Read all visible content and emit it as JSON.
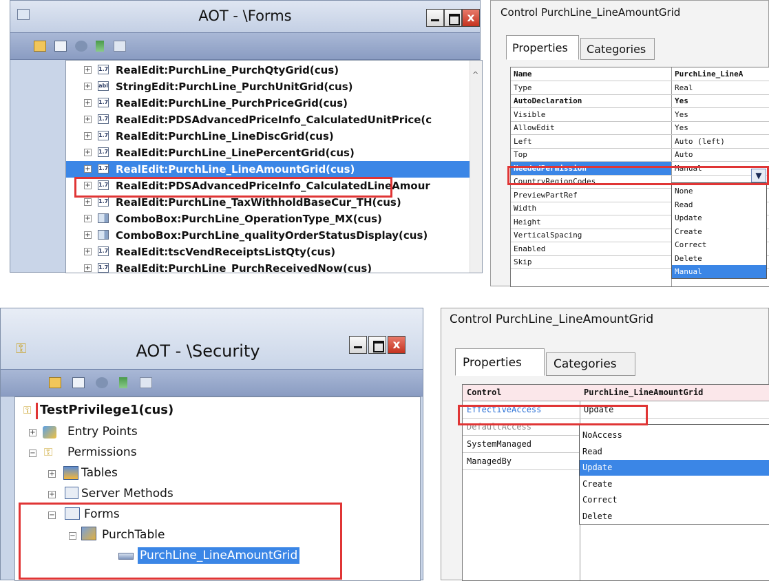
{
  "aot_forms": {
    "title": "AOT - \\Forms",
    "close_label": "x",
    "rows": [
      {
        "icon": "1.7",
        "label": "RealEdit:PurchLine_PurchQtyGrid(cus)"
      },
      {
        "icon": "abl",
        "label": "StringEdit:PurchLine_PurchUnitGrid(cus)"
      },
      {
        "icon": "1.7",
        "label": "RealEdit:PurchLine_PurchPriceGrid(cus)"
      },
      {
        "icon": "1.7",
        "label": "RealEdit:PDSAdvancedPriceInfo_CalculatedUnitPrice(c"
      },
      {
        "icon": "1.7",
        "label": "RealEdit:PurchLine_LineDiscGrid(cus)"
      },
      {
        "icon": "1.7",
        "label": "RealEdit:PurchLine_LinePercentGrid(cus)"
      },
      {
        "icon": "1.7",
        "label": "RealEdit:PurchLine_LineAmountGrid(cus)"
      },
      {
        "icon": "1.7",
        "label": "RealEdit:PDSAdvancedPriceInfo_CalculatedLineAmour"
      },
      {
        "icon": "1.7",
        "label": "RealEdit:PurchLine_TaxWithholdBaseCur_TH(cus)"
      },
      {
        "icon": "",
        "label": "ComboBox:PurchLine_OperationType_MX(cus)"
      },
      {
        "icon": "",
        "label": "ComboBox:PurchLine_qualityOrderStatusDisplay(cus)"
      },
      {
        "icon": "1.7",
        "label": "RealEdit:tscVendReceiptsListQty(cus)"
      },
      {
        "icon": "1.7",
        "label": "RealEdit:PurchLine_PurchReceivedNow(cus)"
      }
    ]
  },
  "props_top": {
    "caption": "Control PurchLine_LineAmountGrid",
    "tabs": [
      "Properties",
      "Categories"
    ],
    "rows": [
      {
        "name": "Name",
        "value": "PurchLine_LineA",
        "bold": true
      },
      {
        "name": "Type",
        "value": "Real"
      },
      {
        "name": "AutoDeclaration",
        "value": "Yes",
        "bold": true
      },
      {
        "name": "Visible",
        "value": "Yes"
      },
      {
        "name": "AllowEdit",
        "value": "Yes"
      },
      {
        "name": "Left",
        "value": "Auto (left)"
      },
      {
        "name": "Top",
        "value": "Auto"
      },
      {
        "name": "NeededPermission",
        "value": "Manual"
      },
      {
        "name": "CountryRegionCodes",
        "value": ""
      },
      {
        "name": "PreviewPartRef",
        "value": ""
      },
      {
        "name": "Width",
        "value": ""
      },
      {
        "name": "Height",
        "value": ""
      },
      {
        "name": "VerticalSpacing",
        "value": ""
      },
      {
        "name": "Enabled",
        "value": ""
      },
      {
        "name": "Skip",
        "value": ""
      }
    ],
    "dropdown_options": [
      "None",
      "Read",
      "Update",
      "Create",
      "Correct",
      "Delete",
      "Manual"
    ],
    "dropdown_selected": "Manual"
  },
  "aot_security": {
    "title": "AOT - \\Security",
    "close_label": "x",
    "root": "TestPrivilege1(cus)",
    "entry_points": "Entry Points",
    "permissions": "Permissions",
    "tables": "Tables",
    "server_methods": "Server Methods",
    "forms": "Forms",
    "purch_table": "PurchTable",
    "leaf": "PurchLine_LineAmountGrid"
  },
  "props_bottom": {
    "caption": "Control PurchLine_LineAmountGrid",
    "tabs": [
      "Properties",
      "Categories"
    ],
    "header_name": "Control",
    "header_value": "PurchLine_LineAmountGrid",
    "rows": [
      {
        "name": "EffectiveAccess",
        "value": "Update"
      },
      {
        "name": "DefaultAccess",
        "value": ""
      },
      {
        "name": "SystemManaged",
        "value": ""
      },
      {
        "name": "ManagedBy",
        "value": ""
      }
    ],
    "dropdown_options": [
      "NoAccess",
      "Read",
      "Update",
      "Create",
      "Correct",
      "Delete"
    ],
    "dropdown_selected": "Update"
  },
  "colors": {
    "highlight_red": "#e03535",
    "selection_blue": "#3b86e6"
  }
}
